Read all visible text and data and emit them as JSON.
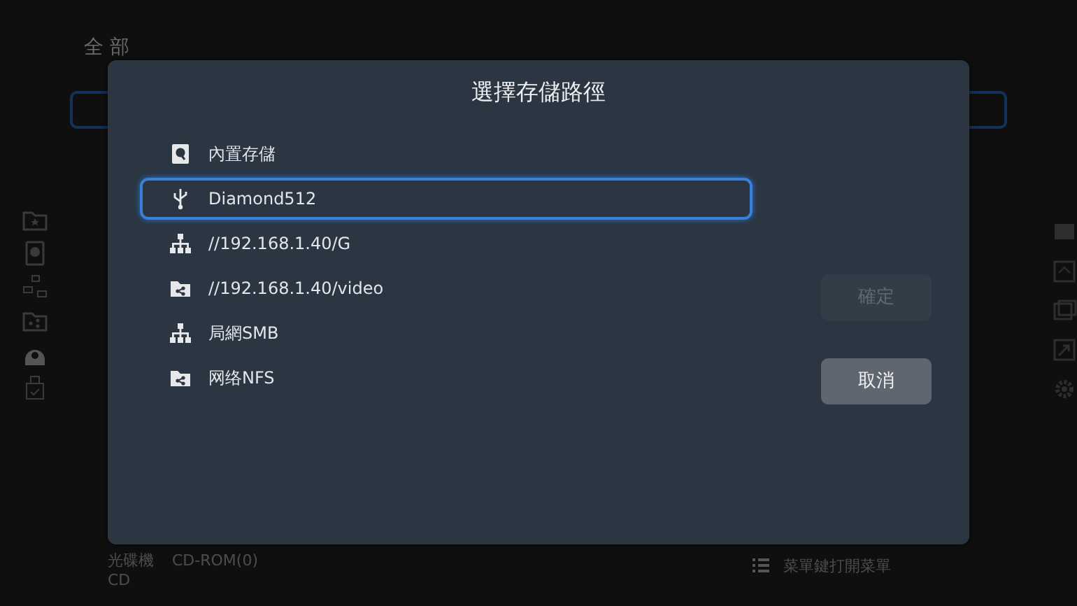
{
  "background": {
    "breadcrumb": "全 部",
    "footer": {
      "drive_label": "光碟機",
      "drive_value": "CD-ROM(0)",
      "drive_type": "CD",
      "hint": "菜單鍵打開菜單"
    }
  },
  "dialog": {
    "title": "選擇存儲路徑",
    "items": [
      {
        "label": "內置存儲",
        "kind": "hdd",
        "selected": false
      },
      {
        "label": "Diamond512",
        "kind": "usb",
        "selected": true
      },
      {
        "label": "//192.168.1.40/G",
        "kind": "network",
        "selected": false
      },
      {
        "label": "//192.168.1.40/video",
        "kind": "share",
        "selected": false
      },
      {
        "label": "局網SMB",
        "kind": "network",
        "selected": false
      },
      {
        "label": "网络NFS",
        "kind": "share",
        "selected": false
      }
    ],
    "buttons": [
      {
        "label": "確定",
        "disabled": true
      },
      {
        "label": "取消",
        "disabled": false
      }
    ]
  }
}
